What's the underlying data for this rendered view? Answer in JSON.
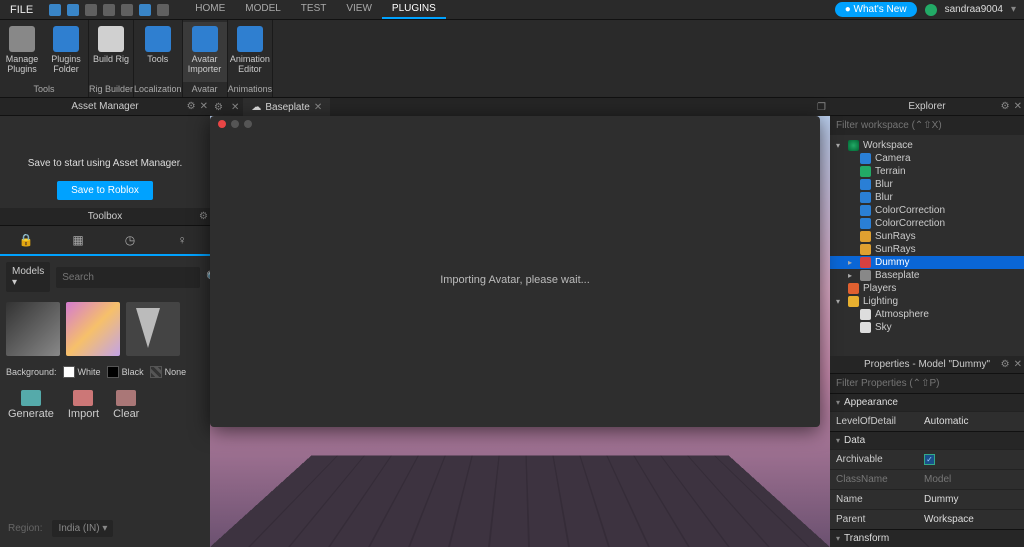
{
  "topbar": {
    "file": "FILE",
    "tabs": [
      "HOME",
      "MODEL",
      "TEST",
      "VIEW",
      "PLUGINS"
    ],
    "active_tab": "PLUGINS",
    "whats_new": "What's New",
    "username": "sandraa9004"
  },
  "ribbon": {
    "groups": [
      {
        "label": "Tools",
        "buttons": [
          {
            "label": "Manage Plugins",
            "color": "#888"
          },
          {
            "label": "Plugins Folder",
            "color": "#2f7fd0"
          }
        ]
      },
      {
        "label": "Rig Builder",
        "buttons": [
          {
            "label": "Build Rig",
            "color": "#d0d0d0"
          }
        ]
      },
      {
        "label": "Localization",
        "buttons": [
          {
            "label": "Tools",
            "color": "#2f7fd0"
          }
        ]
      },
      {
        "label": "Avatar",
        "buttons": [
          {
            "label": "Avatar Importer",
            "color": "#2f7fd0",
            "active": true
          }
        ]
      },
      {
        "label": "Animations",
        "buttons": [
          {
            "label": "Animation Editor",
            "color": "#2f7fd0"
          }
        ]
      }
    ]
  },
  "left": {
    "asset_manager_title": "Asset Manager",
    "asset_message": "Save to start using Asset Manager.",
    "save_button": "Save to Roblox",
    "toolbox_title": "Toolbox",
    "toolbox_tabs": {
      "icons": [
        "lock",
        "grid",
        "clock",
        "bulb"
      ]
    },
    "models_label": "Models",
    "search_placeholder": "Search",
    "background_label": "Background:",
    "bg_white": "White",
    "bg_black": "Black",
    "bg_none": "None",
    "actions": {
      "generate": "Generate",
      "import": "Import",
      "clear": "Clear"
    },
    "region_label": "Region:",
    "region_value": "India (IN)"
  },
  "center": {
    "doc_tab": "Baseplate",
    "dialog_text": "Importing Avatar, please wait..."
  },
  "explorer": {
    "title": "Explorer",
    "filter_placeholder": "Filter workspace (⌃⇧X)",
    "tree": [
      {
        "d": 0,
        "icon": "ni-world",
        "label": "Workspace",
        "arrow": "▾"
      },
      {
        "d": 1,
        "icon": "ni-blue",
        "label": "Camera"
      },
      {
        "d": 1,
        "icon": "ni-green",
        "label": "Terrain"
      },
      {
        "d": 1,
        "icon": "ni-blue",
        "label": "Blur"
      },
      {
        "d": 1,
        "icon": "ni-blue",
        "label": "Blur"
      },
      {
        "d": 1,
        "icon": "ni-blue",
        "label": "ColorCorrection"
      },
      {
        "d": 1,
        "icon": "ni-blue",
        "label": "ColorCorrection"
      },
      {
        "d": 1,
        "icon": "ni-orange",
        "label": "SunRays"
      },
      {
        "d": 1,
        "icon": "ni-orange",
        "label": "SunRays"
      },
      {
        "d": 1,
        "icon": "ni-red",
        "label": "Dummy",
        "arrow": "▸",
        "selected": true
      },
      {
        "d": 1,
        "icon": "ni-grey",
        "label": "Baseplate",
        "arrow": "▸"
      },
      {
        "d": 0,
        "icon": "ni-players",
        "label": "Players"
      },
      {
        "d": 0,
        "icon": "ni-light",
        "label": "Lighting",
        "arrow": "▾"
      },
      {
        "d": 1,
        "icon": "ni-white",
        "label": "Atmosphere"
      },
      {
        "d": 1,
        "icon": "ni-white",
        "label": "Sky"
      }
    ]
  },
  "properties": {
    "title": "Properties - Model \"Dummy\"",
    "filter_placeholder": "Filter Properties (⌃⇧P)",
    "sections": {
      "appearance": "Appearance",
      "data": "Data",
      "transform": "Transform"
    },
    "rows": {
      "LevelOfDetail": "Automatic",
      "Archivable_checked": "✓",
      "ClassName": "Model",
      "Name": "Dummy",
      "Parent": "Workspace"
    },
    "keys": {
      "LevelOfDetail": "LevelOfDetail",
      "Archivable": "Archivable",
      "ClassName": "ClassName",
      "Name": "Name",
      "Parent": "Parent"
    }
  }
}
